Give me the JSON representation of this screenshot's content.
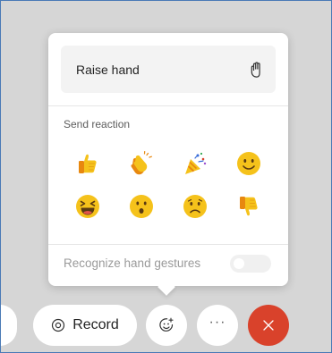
{
  "reaction_panel": {
    "raise_hand": {
      "label": "Raise hand",
      "icon": "raised-hand-icon"
    },
    "section_title": "Send reaction",
    "reactions": [
      {
        "name": "thumbs-up",
        "icon": "thumbs-up-icon"
      },
      {
        "name": "clapping-hands",
        "icon": "clapping-hands-icon"
      },
      {
        "name": "party-popper",
        "icon": "party-popper-icon"
      },
      {
        "name": "smiling-face",
        "icon": "smiling-face-icon"
      },
      {
        "name": "laughing-face",
        "icon": "laughing-face-icon"
      },
      {
        "name": "surprised-face",
        "icon": "surprised-face-icon"
      },
      {
        "name": "sad-face",
        "icon": "sad-face-icon"
      },
      {
        "name": "thumbs-down",
        "icon": "thumbs-down-icon"
      }
    ],
    "gesture_toggle": {
      "label": "Recognize hand gestures",
      "enabled": false
    }
  },
  "toolbar": {
    "record": {
      "label": "Record",
      "icon": "record-icon"
    },
    "react": {
      "icon": "emoji-add-icon"
    },
    "more": {
      "label": "···",
      "icon": "more-icon"
    },
    "close": {
      "icon": "close-icon"
    }
  },
  "colors": {
    "background": "#d6d6d6",
    "emoji_yellow": "#f5c21b",
    "close_red": "#d9422b",
    "frame_border": "#4a7ab6"
  }
}
